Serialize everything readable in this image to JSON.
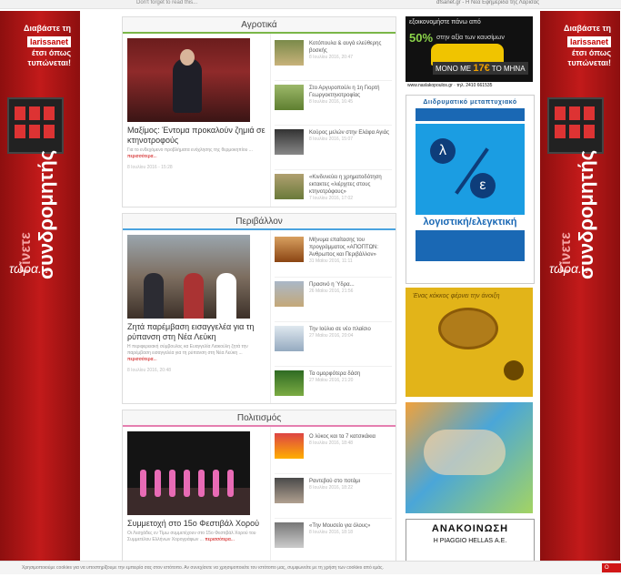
{
  "top_bar": {
    "left_text": "Don't forget to read this...",
    "right_text": "dfsanet.gr - Η Νέα Εφημερίδα της Λάρισας"
  },
  "side_ad": {
    "line1": "Διαβάστε τη",
    "brand": "larissanet",
    "line2": "έτσι όπως",
    "line3": "τυπώνεται!",
    "vertical_small": "Γίνετε",
    "vertical_big": "συνδρομητής",
    "now": "τώρα..."
  },
  "sections": [
    {
      "title": "Αγροτικά",
      "featured": {
        "headline": "Μαξίμος: Έντομα προκαλούν ζημιά σε κτηνοτροφούς",
        "excerpt": "Για το ενδεχόμενο προβλήματα ενόχλησης της θερμοκηπίου ...",
        "more": "περισσότερα...",
        "date": "8 Ιουλίου 2016 - 15:28"
      },
      "items": [
        {
          "title": "Κοτόπουλα & αυγά ελεύθερης βοσκής",
          "date": "8 Ιουλίου 2016, 20:47"
        },
        {
          "title": "Στο Αργυροπούλι η 1η Γιορτή Γεωργοκτηνοτροφίας",
          "date": "8 Ιουλίου 2016, 16:45"
        },
        {
          "title": "Κούρος μελών στην Ελάφα Αγιάς",
          "date": "8 Ιουλίου 2016, 15:07"
        },
        {
          "title": "«Κινδυνεύει η χρηματοδότηση εκτακτες «λιέρχιτες στους κτηνοτρόφους»",
          "date": "7 Ιουλίου 2016, 17:02"
        }
      ]
    },
    {
      "title": "Περιβάλλον",
      "featured": {
        "headline": "Ζητά παρέμβαση εισαγγελέα για τη ρύπανση στη Νέα Λεύκη",
        "excerpt": "Η περιφερειακή σύμβουλος κα Ευαγγελία Λιακούλη ζητά την παρέμβαση εισαγγελέα για τη ρύπανση στη Νέα Λεύκη ...",
        "more": "περισσότερα...",
        "date": "8 Ιουλίου 2016, 20:48"
      },
      "items": [
        {
          "title": "Μήνυμα επαίτασης του προγράμματος «ΑΠΟΠΤΩΝ: Άνθρωπος και Περιβάλλον»",
          "date": "31 Μαΐου 2016, 11:11"
        },
        {
          "title": "Πρασινό η Ύδρα...",
          "date": "26 Μαΐου 2016, 21:56"
        },
        {
          "title": "Την Ιούλιο σε νέο πλαίσιο",
          "date": "27 Μαΐου 2016, 20:04"
        },
        {
          "title": "Τα ομορφότερα δάση",
          "date": "27 Μαΐου 2016, 21:20"
        }
      ]
    },
    {
      "title": "Πολιτισμός",
      "featured": {
        "headline": "Συμμετοχή στο 15ο Φεστιβάλ Χορού",
        "excerpt": "Οι Λεσχάδες εν Τίμω συμμετέχουν στο 15ο Φεστιβάλ Χορού του Συμμετέλου Ελλήνων Χορογράφων ...",
        "more": "περισσότερα...",
        "date": ""
      },
      "items": [
        {
          "title": "Ο λύκος και τα 7 κατσικάκια",
          "date": "8 Ιουλίου 2016, 18:48"
        },
        {
          "title": "Ραντεβού στο ποτάμι",
          "date": "8 Ιουλίου 2016, 18:22"
        },
        {
          "title": "«Την Μουσείο για όλους»",
          "date": "8 Ιουλίου 2016, 18:18"
        }
      ]
    }
  ],
  "ads": {
    "taxi": {
      "top": "εξοικονομήστε πάνω από",
      "pct": "50%",
      "rest": "στην αξία των καυσίμων",
      "price_pre": "ΜΟΝΟ ΜΕ",
      "price": "17€",
      "price_post": "ΤΟ ΜΗΝΑ",
      "url": "www.naslakopoulos.gr · τηλ. 2410 661535"
    },
    "accounting": {
      "header": "Διιδρυματικό μεταπτυχιακό",
      "lambda": "λ",
      "epsilon": "ε",
      "big": "λογιστική/ελεγκτική"
    },
    "tea": {
      "quote": "Ένας κόκκος φέρνει την άνοιξη"
    },
    "notice": {
      "title": "ΑΝΑΚΟΙΝΩΣΗ",
      "company": "Η PIAGGIO HELLAS Α.Ε."
    }
  },
  "cookie_bar": {
    "text": "Χρησιμοποιούμε cookies για να υποστηρίξουμε την εμπειρία σας στον ιστότοπο. Αν συνεχίσετε να χρησιμοποιείτε τον ιστότοπο μας, συμφωνείτε με τη χρήση των cookies από εμάς.",
    "button": "Ο"
  }
}
